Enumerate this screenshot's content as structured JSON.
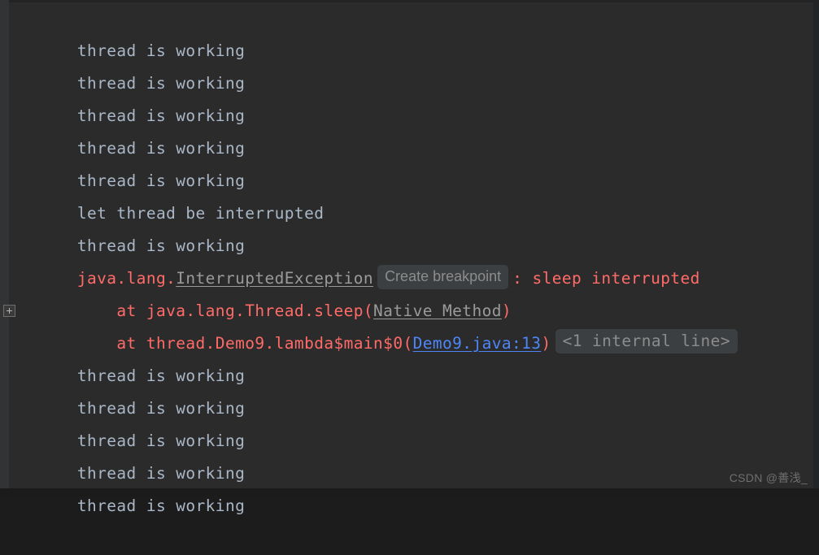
{
  "theme": {
    "background": "#2b2b2b",
    "gutter_left": "#313335",
    "gutter_right": "#232425",
    "bottom_bar": "#1b1b1b",
    "text_normal": "#a9b7c6",
    "text_error": "#ff6b68",
    "link_gray": "#9a9a9a",
    "link_blue": "#4e86f7",
    "badge_background": "#3c3f41",
    "badge_text": "#8c8c8c"
  },
  "console": {
    "lines": [
      {
        "id": "line-1",
        "type": "output",
        "text": "thread is working"
      },
      {
        "id": "line-2",
        "type": "output",
        "text": "thread is working"
      },
      {
        "id": "line-3",
        "type": "output",
        "text": "thread is working"
      },
      {
        "id": "line-4",
        "type": "output",
        "text": "thread is working"
      },
      {
        "id": "line-5",
        "type": "output",
        "text": "thread is working"
      },
      {
        "id": "line-6",
        "type": "output",
        "text": "let thread be interrupted"
      },
      {
        "id": "line-7",
        "type": "output",
        "text": "thread is working"
      },
      {
        "id": "line-8",
        "type": "exception-header",
        "prefix": "java.lang.",
        "exception_name": "InterruptedException",
        "badge": "Create breakpoint",
        "separator": ":",
        "message": "sleep interrupted"
      },
      {
        "id": "line-9",
        "type": "stack-frame",
        "frame": "    at java.lang.Thread.sleep(",
        "location": "Native Method",
        "suffix": ")"
      },
      {
        "id": "line-10",
        "type": "stack-frame-expandable",
        "frame": "    at thread.Demo9.lambda$main$0(",
        "location": "Demo9.java:13",
        "suffix": ")",
        "badge": "<1 internal line>",
        "expand_icon": "plus-box-icon"
      },
      {
        "id": "line-11",
        "type": "output",
        "text": "thread is working"
      },
      {
        "id": "line-12",
        "type": "output",
        "text": "thread is working"
      },
      {
        "id": "line-13",
        "type": "output",
        "text": "thread is working"
      },
      {
        "id": "line-14",
        "type": "output",
        "text": "thread is working"
      },
      {
        "id": "line-15",
        "type": "output",
        "text": "thread is working"
      }
    ]
  },
  "watermark": {
    "text": "CSDN @善浅_"
  }
}
